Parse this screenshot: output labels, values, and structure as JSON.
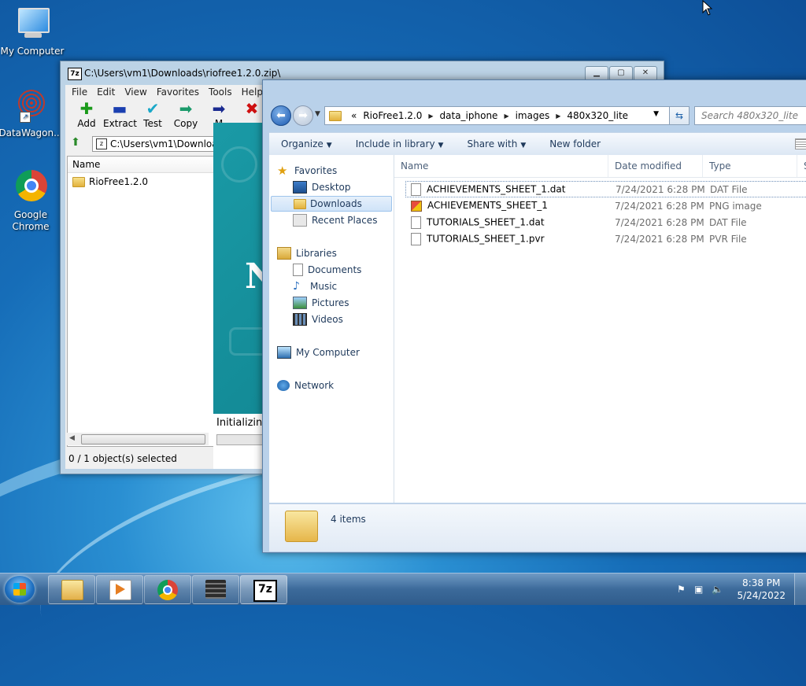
{
  "desktop": {
    "icons": [
      {
        "label": "My Computer"
      },
      {
        "label": "DataWagon..."
      },
      {
        "label": "Google Chrome"
      }
    ]
  },
  "sevenzip": {
    "title": "C:\\Users\\vm1\\Downloads\\riofree1.2.0.zip\\",
    "app_icon_text": "7z",
    "menu": [
      "File",
      "Edit",
      "View",
      "Favorites",
      "Tools",
      "Help"
    ],
    "toolbar": [
      "Add",
      "Extract",
      "Test",
      "Copy",
      "M"
    ],
    "address": "C:\\Users\\vm1\\Downloa",
    "list_header": "Name",
    "items": [
      "RioFree1.2.0"
    ],
    "status": "0 / 1 object(s) selected",
    "progress_text": "Initializing",
    "splash_glyph": "N"
  },
  "explorer": {
    "breadcrumb_prefix": "«",
    "breadcrumb": [
      "RioFree1.2.0",
      "data_iphone",
      "images",
      "480x320_lite"
    ],
    "search_placeholder": "Search 480x320_lite",
    "commands": [
      "Organize",
      "Include in library",
      "Share with",
      "New folder"
    ],
    "nav": {
      "favorites": "Favorites",
      "desktop": "Desktop",
      "downloads": "Downloads",
      "recent": "Recent Places",
      "libraries": "Libraries",
      "documents": "Documents",
      "music": "Music",
      "pictures": "Pictures",
      "videos": "Videos",
      "computer": "My Computer",
      "network": "Network"
    },
    "columns": [
      "Name",
      "Date modified",
      "Type",
      "S"
    ],
    "files": [
      {
        "name": "ACHIEVEMENTS_SHEET_1.dat",
        "date": "7/24/2021 6:28 PM",
        "type": "DAT File"
      },
      {
        "name": "ACHIEVEMENTS_SHEET_1",
        "date": "7/24/2021 6:28 PM",
        "type": "PNG image"
      },
      {
        "name": "TUTORIALS_SHEET_1.dat",
        "date": "7/24/2021 6:28 PM",
        "type": "DAT File"
      },
      {
        "name": "TUTORIALS_SHEET_1.pvr",
        "date": "7/24/2021 6:28 PM",
        "type": "PVR File"
      }
    ],
    "item_count": "4 items"
  },
  "taskbar": {
    "sevenzip_label": "7z",
    "time": "8:38 PM",
    "date": "5/24/2022"
  }
}
